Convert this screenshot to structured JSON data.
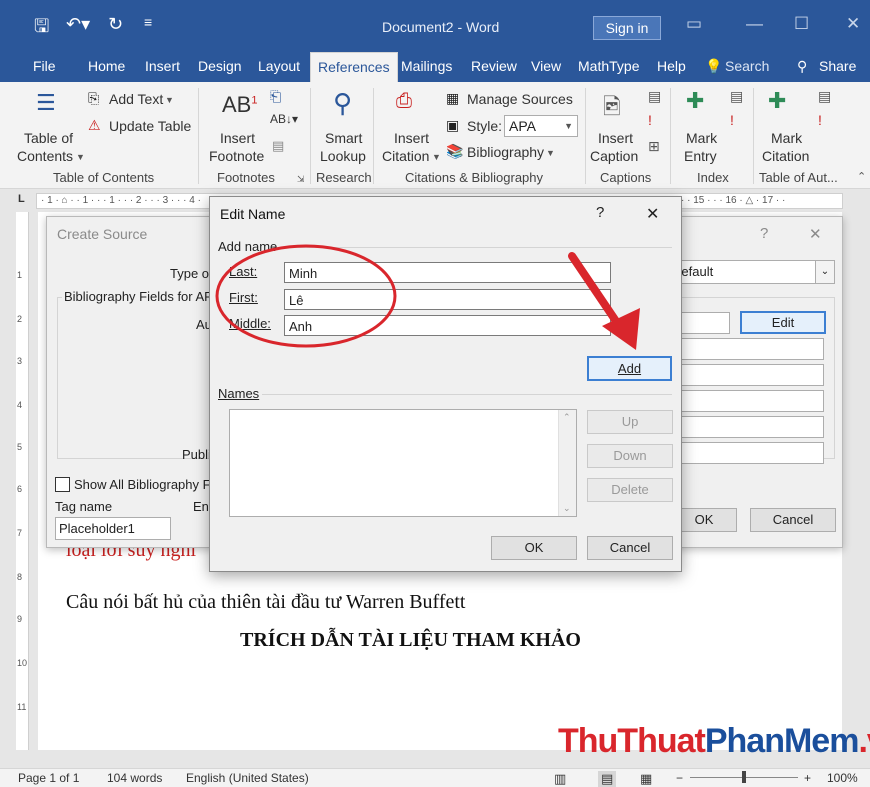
{
  "window": {
    "title": "Document2 - Word",
    "sign_in": "Sign in"
  },
  "tabs": [
    "File",
    "Home",
    "Insert",
    "Design",
    "Layout",
    "References",
    "Mailings",
    "Review",
    "View",
    "MathType",
    "Help"
  ],
  "tab_search": "Search",
  "tab_share": "Share",
  "ribbon": {
    "toc": {
      "line1": "Table of",
      "line2": "Contents",
      "add_text": "Add Text",
      "update_table": "Update Table",
      "group": "Table of Contents"
    },
    "footnotes": {
      "line1": "Insert",
      "line2": "Footnote",
      "group": "Footnotes"
    },
    "research": {
      "line1": "Smart",
      "line2": "Lookup",
      "group": "Research"
    },
    "citations": {
      "insert1": "Insert",
      "insert2": "Citation",
      "manage": "Manage Sources",
      "style_label": "Style:",
      "style_value": "APA",
      "bibliography": "Bibliography",
      "group": "Citations & Bibliography"
    },
    "captions": {
      "line1": "Insert",
      "line2": "Caption",
      "group": "Captions"
    },
    "index": {
      "line1": "Mark",
      "line2": "Entry",
      "group": "Index"
    },
    "toa": {
      "line1": "Mark",
      "line2": "Citation",
      "group": "Table of Aut..."
    }
  },
  "ruler": "· 1 · ⌂ · · 1 · · · 1 · · · 2 · · · 3 · · · 4 ·",
  "ruler_right": "· · 15 · · · 16 · △ · 17 · ·",
  "vruler": [
    "1",
    "2",
    "3",
    "4",
    "5",
    "6",
    "7",
    "8",
    "9",
    "10",
    "11"
  ],
  "document": {
    "red_line": "loại lời suy nghĩ",
    "line1": "Câu nói bất hủ của thiên tài đầu tư Warren Buffett",
    "heading": "TRÍCH DẪN TÀI LIỆU THAM KHẢO"
  },
  "create_source": {
    "title": "Create Source",
    "type_of": "Type of",
    "fields_for": "Bibliography Fields for AP",
    "author": "Au",
    "publisher": "Publi",
    "language": "Default",
    "edit_button": "Edit",
    "show_all": "Show All Bibliography F",
    "tag_name_label": "Tag name",
    "entry_label": "Ent",
    "tag_name_value": "Placeholder1",
    "ok": "OK",
    "cancel": "Cancel",
    "help": "?",
    "close": "✕"
  },
  "edit_name": {
    "title": "Edit Name",
    "help": "?",
    "close": "✕",
    "add_name": "Add name",
    "last_label": "Last:",
    "first_label": "First:",
    "middle_label": "Middle:",
    "last_value": "Minh",
    "first_value": "Lê",
    "middle_value": "Anh",
    "add": "Add",
    "names_label": "Names",
    "up": "Up",
    "down": "Down",
    "delete": "Delete",
    "ok": "OK",
    "cancel": "Cancel"
  },
  "status": {
    "page": "Page 1 of 1",
    "words": "104 words",
    "language": "English (United States)",
    "zoom": "100%"
  },
  "watermark": {
    "part1": "ThuThuat",
    "part2": "PhanMem",
    "part3": ".vn"
  },
  "colors": {
    "accent": "#2b579a",
    "annotation": "#d9262c",
    "watermark_red": "#d9262c",
    "watermark_blue": "#1b4f9c"
  }
}
